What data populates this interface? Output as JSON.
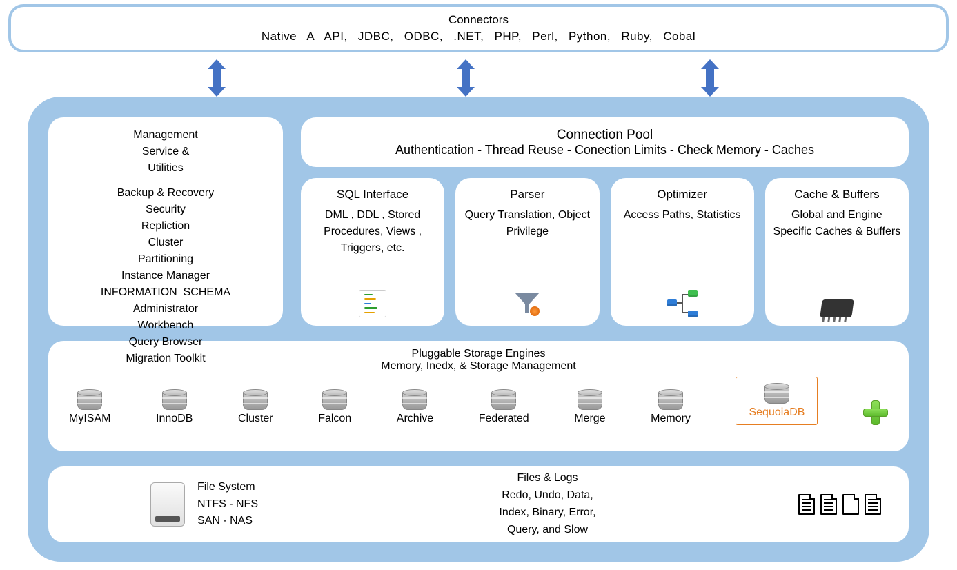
{
  "connectors": {
    "title": "Connectors",
    "list": "Native  A  API,    JDBC,    ODBC,    .NET,    PHP,    Perl,    Python,    Ruby,    Cobal"
  },
  "management": {
    "heading_l1": "Management",
    "heading_l2": "Service &",
    "heading_l3": "Utilities",
    "items": [
      "Backup & Recovery",
      "Security",
      "Repliction",
      "Cluster",
      "Partitioning",
      "Instance Manager",
      "INFORMATION_SCHEMA",
      "Administrator",
      "Workbench",
      "Query Browser",
      "Migration Toolkit"
    ]
  },
  "pool": {
    "title": "Connection Pool",
    "line": "Authentication - Thread Reuse - Conection Limits - Check Memory - Caches"
  },
  "subcards": [
    {
      "title": "SQL Interface",
      "desc": "DML , DDL , Stored Procedures, Views , Triggers, etc."
    },
    {
      "title": "Parser",
      "desc": "Query Translation, Object Privilege"
    },
    {
      "title": "Optimizer",
      "desc": "Access Paths, Statistics"
    },
    {
      "title": "Cache & Buffers",
      "desc": "Global and Engine Specific Caches & Buffers"
    }
  ],
  "engines": {
    "title": "Pluggable Storage Engines",
    "subtitle": "Memory, Inedx, & Storage Management",
    "list": [
      "MyISAM",
      "InnoDB",
      "Cluster",
      "Falcon",
      "Archive",
      "Federated",
      "Merge",
      "Memory"
    ],
    "highlight": "SequoiaDB"
  },
  "filesystem": {
    "title": "File System",
    "line1": "NTFS - NFS",
    "line2": "SAN - NAS"
  },
  "fileslogs": {
    "title": "Files &  Logs",
    "line1": "Redo, Undo, Data,",
    "line2": "Index, Binary, Error,",
    "line3": "Query,  and Slow"
  }
}
